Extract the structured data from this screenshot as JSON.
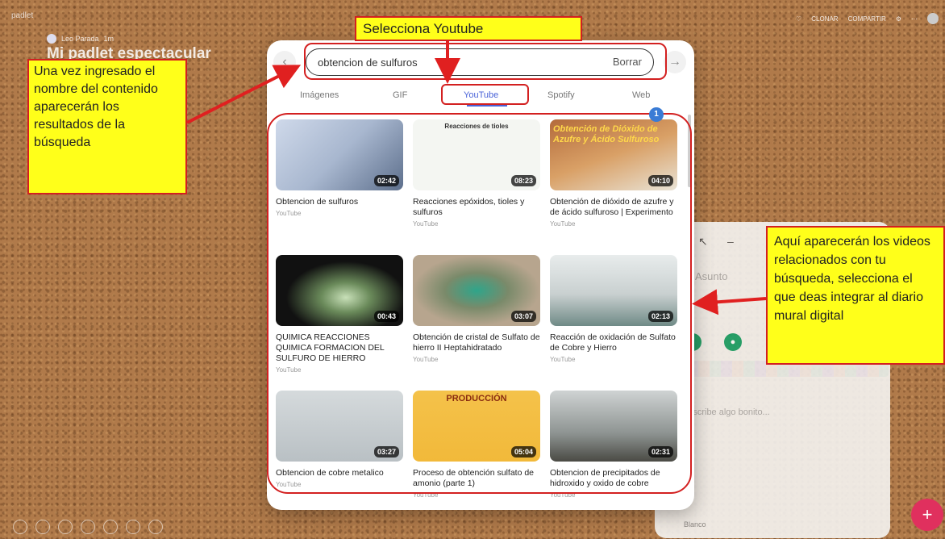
{
  "app": {
    "name": "padlet",
    "author": "Leo Parada",
    "time": "1m",
    "board_title": "Mi padlet espectacular"
  },
  "top_actions": {
    "clone": "CLONAR",
    "share": "COMPARTIR"
  },
  "search": {
    "query": "obtencion de sulfuros",
    "clear_label": "Borrar"
  },
  "tabs": [
    {
      "label": "Imágenes",
      "active": false
    },
    {
      "label": "GIF",
      "active": false
    },
    {
      "label": "YouTube",
      "active": true
    },
    {
      "label": "Spotify",
      "active": false
    },
    {
      "label": "Web",
      "active": false
    }
  ],
  "results": [
    {
      "title": "Obtencion de sulfuros",
      "source": "YouTube",
      "duration": "02:42",
      "overlay": ""
    },
    {
      "title": "Reacciones epóxidos, tioles y sulfuros",
      "source": "YouTube",
      "duration": "08:23",
      "overlay": "Reacciones de tioles"
    },
    {
      "title": "Obtención de dióxido de azufre y de ácido sulfuroso | Experimento",
      "source": "YouTube",
      "duration": "04:10",
      "overlay": "Obtención de Dióxido de Azufre y Ácido Sulfuroso"
    },
    {
      "title": "QUIMICA REACCIONES QUIMICA FORMACION DEL SULFURO DE HIERRO",
      "source": "YouTube",
      "duration": "00:43",
      "overlay": ""
    },
    {
      "title": "Obtención de cristal de Sulfato de hierro II Heptahidratado",
      "source": "YouTube",
      "duration": "03:07",
      "overlay": ""
    },
    {
      "title": "Reacción de oxidación de Sulfato de Cobre y Hierro",
      "source": "YouTube",
      "duration": "02:13",
      "overlay": ""
    },
    {
      "title": "Obtencion de cobre metalico",
      "source": "YouTube",
      "duration": "03:27",
      "overlay": ""
    },
    {
      "title": "Proceso de obtención sulfato de amonio (parte 1)",
      "source": "YouTube",
      "duration": "05:04",
      "overlay": "PRODUCCIÓN"
    },
    {
      "title": "Obtencion de precipitados de hidroxido y oxido de cobre",
      "source": "YouTube",
      "duration": "02:31",
      "overlay": ""
    }
  ],
  "badge_count": "1",
  "composer": {
    "placeholder_title": "Asunto",
    "placeholder_body": "Escribe algo bonito...",
    "color_label": "Blanco"
  },
  "annotations": {
    "top": "Selecciona Youtube",
    "left": "Una vez ingresado el nombre del contenido aparecerán los resultados de la búsqueda",
    "right": "Aquí aparecerán los videos relacionados con tu búsqueda, selecciona el que deas integrar al diario mural digital"
  },
  "colors": {
    "accent": "#4a63d8",
    "annotation_bg": "#ffff1a",
    "annotation_border": "#d32020",
    "fab": "#e0305e",
    "cork": "#b07a4a"
  }
}
